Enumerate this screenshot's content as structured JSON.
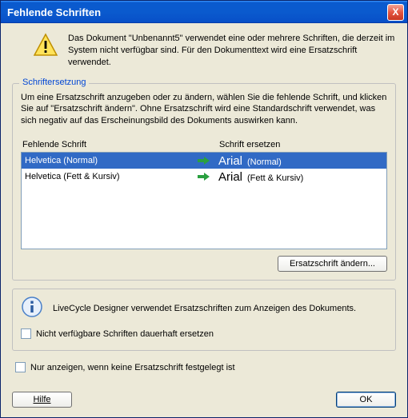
{
  "title": "Fehlende Schriften",
  "close_x": "X",
  "warning_text": "Das Dokument \"Unbenannt5\" verwendet eine oder mehrere Schriften, die derzeit im System nicht verfügbar sind. Für den Dokumenttext wird eine Ersatzschrift verwendet.",
  "group": {
    "title": "Schriftersetzung",
    "desc": "Um eine Ersatzschrift anzugeben oder zu ändern, wählen Sie die fehlende Schrift, und klicken Sie auf \"Ersatzschrift ändern\". Ohne Ersatzschrift wird eine Standardschrift verwendet, was sich negativ auf das Erscheinungsbild des Dokuments auswirken kann.",
    "col1": "Fehlende Schrift",
    "col2": "Schrift ersetzen",
    "rows": [
      {
        "missing": "Helvetica (Normal)",
        "subst_font": "Arial",
        "subst_style": "(Normal)",
        "selected": true
      },
      {
        "missing": "Helvetica (Fett & Kursiv)",
        "subst_font": "Arial",
        "subst_style": "(Fett & Kursiv)",
        "selected": false
      }
    ],
    "change_btn": "Ersatzschrift ändern..."
  },
  "info2_text": "LiveCycle Designer verwendet Ersatzschriften zum Anzeigen des Dokuments.",
  "cb_permanent": "Nicht verfügbare Schriften dauerhaft ersetzen",
  "cb_only_show": "Nur anzeigen, wenn keine Ersatzschrift festgelegt ist",
  "help_btn": "Hilfe",
  "ok_btn": "OK",
  "colors": {
    "selection": "#316ac5",
    "titlebar": "#0a5ace"
  }
}
